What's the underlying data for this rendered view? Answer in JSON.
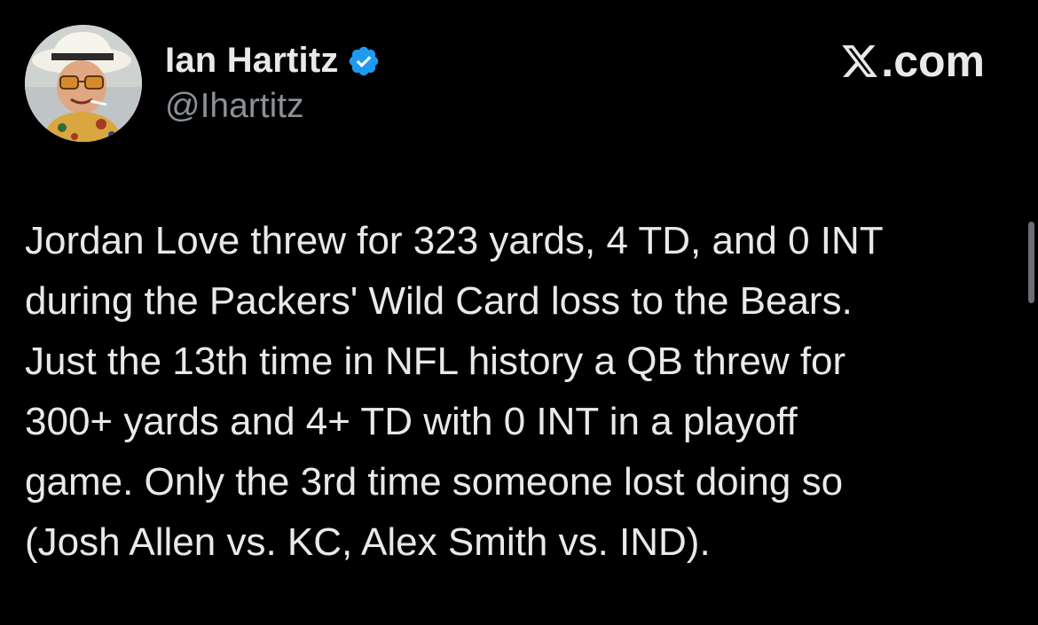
{
  "author": {
    "display_name": "Ian Hartitz",
    "handle": "@Ihartitz",
    "verified_icon": "verified-badge-icon",
    "avatar_icon": "avatar-photo"
  },
  "brand": {
    "label": ".com",
    "logo_icon": "x-logo-icon"
  },
  "tweet": {
    "lines": [
      "Jordan Love threw for 323 yards, 4 TD, and 0 INT",
      "during the Packers' Wild Card loss to the Bears.",
      "Just the 13th time in NFL history a QB threw for",
      "300+ yards and 4+ TD with 0 INT in a playoff",
      "game. Only the 3rd time someone lost doing so",
      "(Josh Allen vs. KC, Alex Smith vs. IND)."
    ]
  },
  "colors": {
    "background": "#000000",
    "text_primary": "#e7e9ea",
    "text_secondary": "#8b9197",
    "verified_blue": "#1d9bf0"
  }
}
